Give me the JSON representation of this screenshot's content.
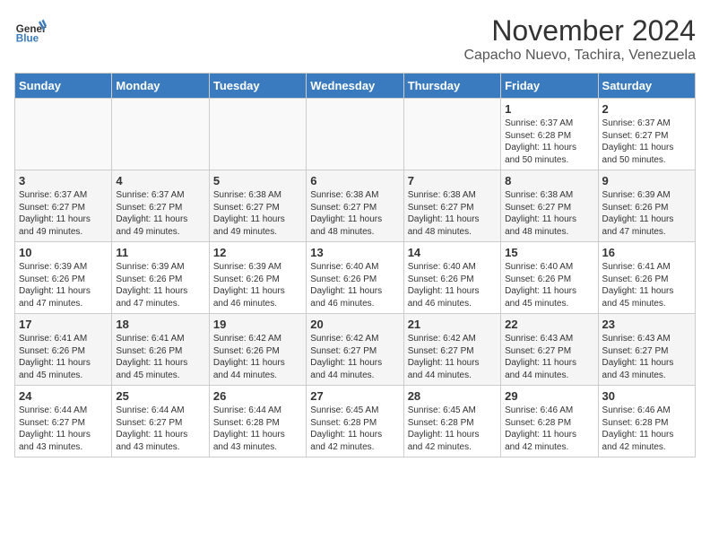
{
  "header": {
    "logo_general": "General",
    "logo_blue": "Blue",
    "month": "November 2024",
    "location": "Capacho Nuevo, Tachira, Venezuela"
  },
  "weekdays": [
    "Sunday",
    "Monday",
    "Tuesday",
    "Wednesday",
    "Thursday",
    "Friday",
    "Saturday"
  ],
  "weeks": [
    [
      {
        "day": "",
        "info": ""
      },
      {
        "day": "",
        "info": ""
      },
      {
        "day": "",
        "info": ""
      },
      {
        "day": "",
        "info": ""
      },
      {
        "day": "",
        "info": ""
      },
      {
        "day": "1",
        "info": "Sunrise: 6:37 AM\nSunset: 6:28 PM\nDaylight: 11 hours\nand 50 minutes."
      },
      {
        "day": "2",
        "info": "Sunrise: 6:37 AM\nSunset: 6:27 PM\nDaylight: 11 hours\nand 50 minutes."
      }
    ],
    [
      {
        "day": "3",
        "info": "Sunrise: 6:37 AM\nSunset: 6:27 PM\nDaylight: 11 hours\nand 49 minutes."
      },
      {
        "day": "4",
        "info": "Sunrise: 6:37 AM\nSunset: 6:27 PM\nDaylight: 11 hours\nand 49 minutes."
      },
      {
        "day": "5",
        "info": "Sunrise: 6:38 AM\nSunset: 6:27 PM\nDaylight: 11 hours\nand 49 minutes."
      },
      {
        "day": "6",
        "info": "Sunrise: 6:38 AM\nSunset: 6:27 PM\nDaylight: 11 hours\nand 48 minutes."
      },
      {
        "day": "7",
        "info": "Sunrise: 6:38 AM\nSunset: 6:27 PM\nDaylight: 11 hours\nand 48 minutes."
      },
      {
        "day": "8",
        "info": "Sunrise: 6:38 AM\nSunset: 6:27 PM\nDaylight: 11 hours\nand 48 minutes."
      },
      {
        "day": "9",
        "info": "Sunrise: 6:39 AM\nSunset: 6:26 PM\nDaylight: 11 hours\nand 47 minutes."
      }
    ],
    [
      {
        "day": "10",
        "info": "Sunrise: 6:39 AM\nSunset: 6:26 PM\nDaylight: 11 hours\nand 47 minutes."
      },
      {
        "day": "11",
        "info": "Sunrise: 6:39 AM\nSunset: 6:26 PM\nDaylight: 11 hours\nand 47 minutes."
      },
      {
        "day": "12",
        "info": "Sunrise: 6:39 AM\nSunset: 6:26 PM\nDaylight: 11 hours\nand 46 minutes."
      },
      {
        "day": "13",
        "info": "Sunrise: 6:40 AM\nSunset: 6:26 PM\nDaylight: 11 hours\nand 46 minutes."
      },
      {
        "day": "14",
        "info": "Sunrise: 6:40 AM\nSunset: 6:26 PM\nDaylight: 11 hours\nand 46 minutes."
      },
      {
        "day": "15",
        "info": "Sunrise: 6:40 AM\nSunset: 6:26 PM\nDaylight: 11 hours\nand 45 minutes."
      },
      {
        "day": "16",
        "info": "Sunrise: 6:41 AM\nSunset: 6:26 PM\nDaylight: 11 hours\nand 45 minutes."
      }
    ],
    [
      {
        "day": "17",
        "info": "Sunrise: 6:41 AM\nSunset: 6:26 PM\nDaylight: 11 hours\nand 45 minutes."
      },
      {
        "day": "18",
        "info": "Sunrise: 6:41 AM\nSunset: 6:26 PM\nDaylight: 11 hours\nand 45 minutes."
      },
      {
        "day": "19",
        "info": "Sunrise: 6:42 AM\nSunset: 6:26 PM\nDaylight: 11 hours\nand 44 minutes."
      },
      {
        "day": "20",
        "info": "Sunrise: 6:42 AM\nSunset: 6:27 PM\nDaylight: 11 hours\nand 44 minutes."
      },
      {
        "day": "21",
        "info": "Sunrise: 6:42 AM\nSunset: 6:27 PM\nDaylight: 11 hours\nand 44 minutes."
      },
      {
        "day": "22",
        "info": "Sunrise: 6:43 AM\nSunset: 6:27 PM\nDaylight: 11 hours\nand 44 minutes."
      },
      {
        "day": "23",
        "info": "Sunrise: 6:43 AM\nSunset: 6:27 PM\nDaylight: 11 hours\nand 43 minutes."
      }
    ],
    [
      {
        "day": "24",
        "info": "Sunrise: 6:44 AM\nSunset: 6:27 PM\nDaylight: 11 hours\nand 43 minutes."
      },
      {
        "day": "25",
        "info": "Sunrise: 6:44 AM\nSunset: 6:27 PM\nDaylight: 11 hours\nand 43 minutes."
      },
      {
        "day": "26",
        "info": "Sunrise: 6:44 AM\nSunset: 6:28 PM\nDaylight: 11 hours\nand 43 minutes."
      },
      {
        "day": "27",
        "info": "Sunrise: 6:45 AM\nSunset: 6:28 PM\nDaylight: 11 hours\nand 42 minutes."
      },
      {
        "day": "28",
        "info": "Sunrise: 6:45 AM\nSunset: 6:28 PM\nDaylight: 11 hours\nand 42 minutes."
      },
      {
        "day": "29",
        "info": "Sunrise: 6:46 AM\nSunset: 6:28 PM\nDaylight: 11 hours\nand 42 minutes."
      },
      {
        "day": "30",
        "info": "Sunrise: 6:46 AM\nSunset: 6:28 PM\nDaylight: 11 hours\nand 42 minutes."
      }
    ]
  ]
}
